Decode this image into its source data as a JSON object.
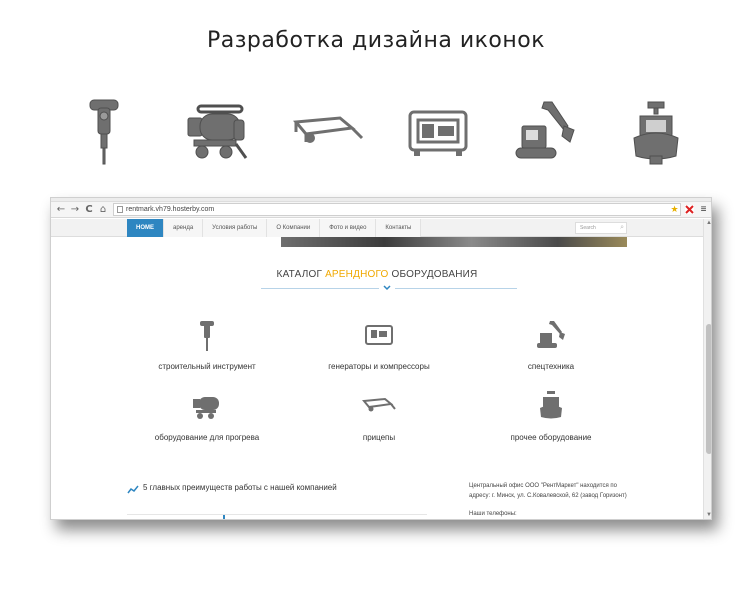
{
  "page": {
    "title": "Разработка дизайна иконок"
  },
  "icon_row": [
    {
      "icon": "jackhammer-icon"
    },
    {
      "icon": "heat-gun-icon"
    },
    {
      "icon": "trailer-icon"
    },
    {
      "icon": "generator-icon"
    },
    {
      "icon": "excavator-icon"
    },
    {
      "icon": "pump-icon"
    }
  ],
  "browser": {
    "url": "rentmark.vh79.hosterby.com",
    "nav_back": "←",
    "nav_forward": "→",
    "nav_reload": "C",
    "nav_home": "⌂",
    "star": "★",
    "menu_glyph": "≡"
  },
  "site": {
    "menu": [
      {
        "label": "HOME",
        "active": true
      },
      {
        "label": "аренда"
      },
      {
        "label": "Условия работы"
      },
      {
        "label": "О Компании"
      },
      {
        "label": "Фото и видео"
      },
      {
        "label": "Контакты"
      }
    ],
    "search_placeholder": "Search",
    "catalog_title_before": "КАТАЛОГ ",
    "catalog_title_accent": "АРЕНДНОГО",
    "catalog_title_after": " ОБОРУДОВАНИЯ",
    "categories": [
      {
        "label": "строительный инструмент",
        "icon": "jackhammer-icon"
      },
      {
        "label": "генераторы и компрессоры",
        "icon": "generator-icon"
      },
      {
        "label": "спецтехника",
        "icon": "excavator-icon"
      },
      {
        "label": "оборудование для прогрева",
        "icon": "heat-gun-icon"
      },
      {
        "label": "прицепы",
        "icon": "trailer-icon"
      },
      {
        "label": "прочее оборудование",
        "icon": "pump-icon"
      }
    ],
    "advantages_title": "5 главных преимуществ работы с нашей компанией",
    "office_text": "Центральный офис ООО \"РентМаркет\" находится по адресу: г. Минск, ул. С.Ковалевской, 62 (завод Горизонт)",
    "phones_label": "Наши телефоны:"
  },
  "colors": {
    "accent_blue": "#2e86c1",
    "accent_orange": "#f0a800",
    "icon_gray": "#6f6f6f"
  }
}
